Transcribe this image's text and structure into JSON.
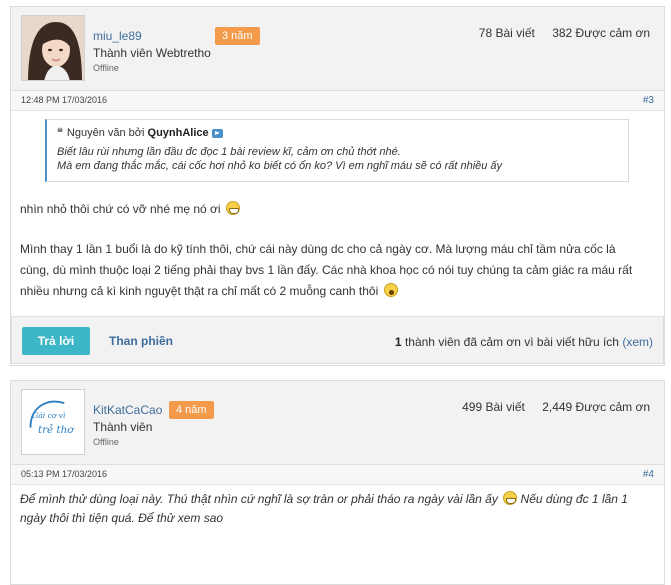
{
  "posts": [
    {
      "username": "miu_le89",
      "badge": "3 năm",
      "rank": "Thành viên Webtretho",
      "status": "Offline",
      "post_count": "78 Bài viết",
      "thanks_count": "382 Được cảm ơn",
      "date": "12:48 PM 17/03/2016",
      "post_number": "#3",
      "quote": {
        "prefix": "Nguyên văn bởi",
        "author": "QuynhAlice",
        "lines": [
          "Biết lâu rùi nhưng lần đầu đc đọc 1 bài review kĩ, cảm ơn chủ thớt nhé.",
          "Mà em đang thắc mắc, cái cốc hơi nhỏ ko biết có ổn ko? Vì em nghĩ máu sẽ có rất nhiều ấy"
        ]
      },
      "message": [
        "nhìn nhỏ thôi chứ có vỡ nhé mẹ nó ơi",
        "Mình thay 1 lần 1 buổi là do kỹ tính thôi, chứ cái này dùng dc cho cả ngày cơ. Mà lượng máu chỉ tầm nửa cốc là cùng, dù mình thuộc loại 2 tiếng phải thay bvs 1 lần đấy. Các nhà khoa học có nói tuy chúng ta cảm giác ra máu rất nhiều nhưng cả kì kinh nguyệt thật ra chỉ mất có 2 muỗng canh thôi"
      ],
      "reply_label": "Trả lời",
      "report_label": "Than phiền",
      "thanks_summary": {
        "count": "1",
        "text": "thành viên đã cảm ơn vì bài viết hữu ích",
        "link": "(xem)"
      }
    },
    {
      "username": "KitKatCaCao",
      "badge": "4 năm",
      "rank": "Thành viên",
      "status": "Offline",
      "post_count": "499 Bài viết",
      "thanks_count": "2,449 Được cảm ơn",
      "date": "05:13 PM 17/03/2016",
      "post_number": "#4",
      "message_part1": "Để mình thử dùng loại này. Thú thật nhìn cứ nghĩ là sợ tràn or phải tháo ra ngày vài lần ấy",
      "message_part2": "Nếu dùng đc 1 lần 1 ngày thôi thì tiện quá. Để thử xem sao",
      "avatar_logo_text": [
        "Gái cơ vì",
        "trẻ thơ"
      ]
    }
  ],
  "colors": {
    "accent_blue": "#3e6d9c",
    "badge_orange": "#f39a4b",
    "reply_button": "#3db7c7",
    "quote_border": "#4a90c8"
  }
}
